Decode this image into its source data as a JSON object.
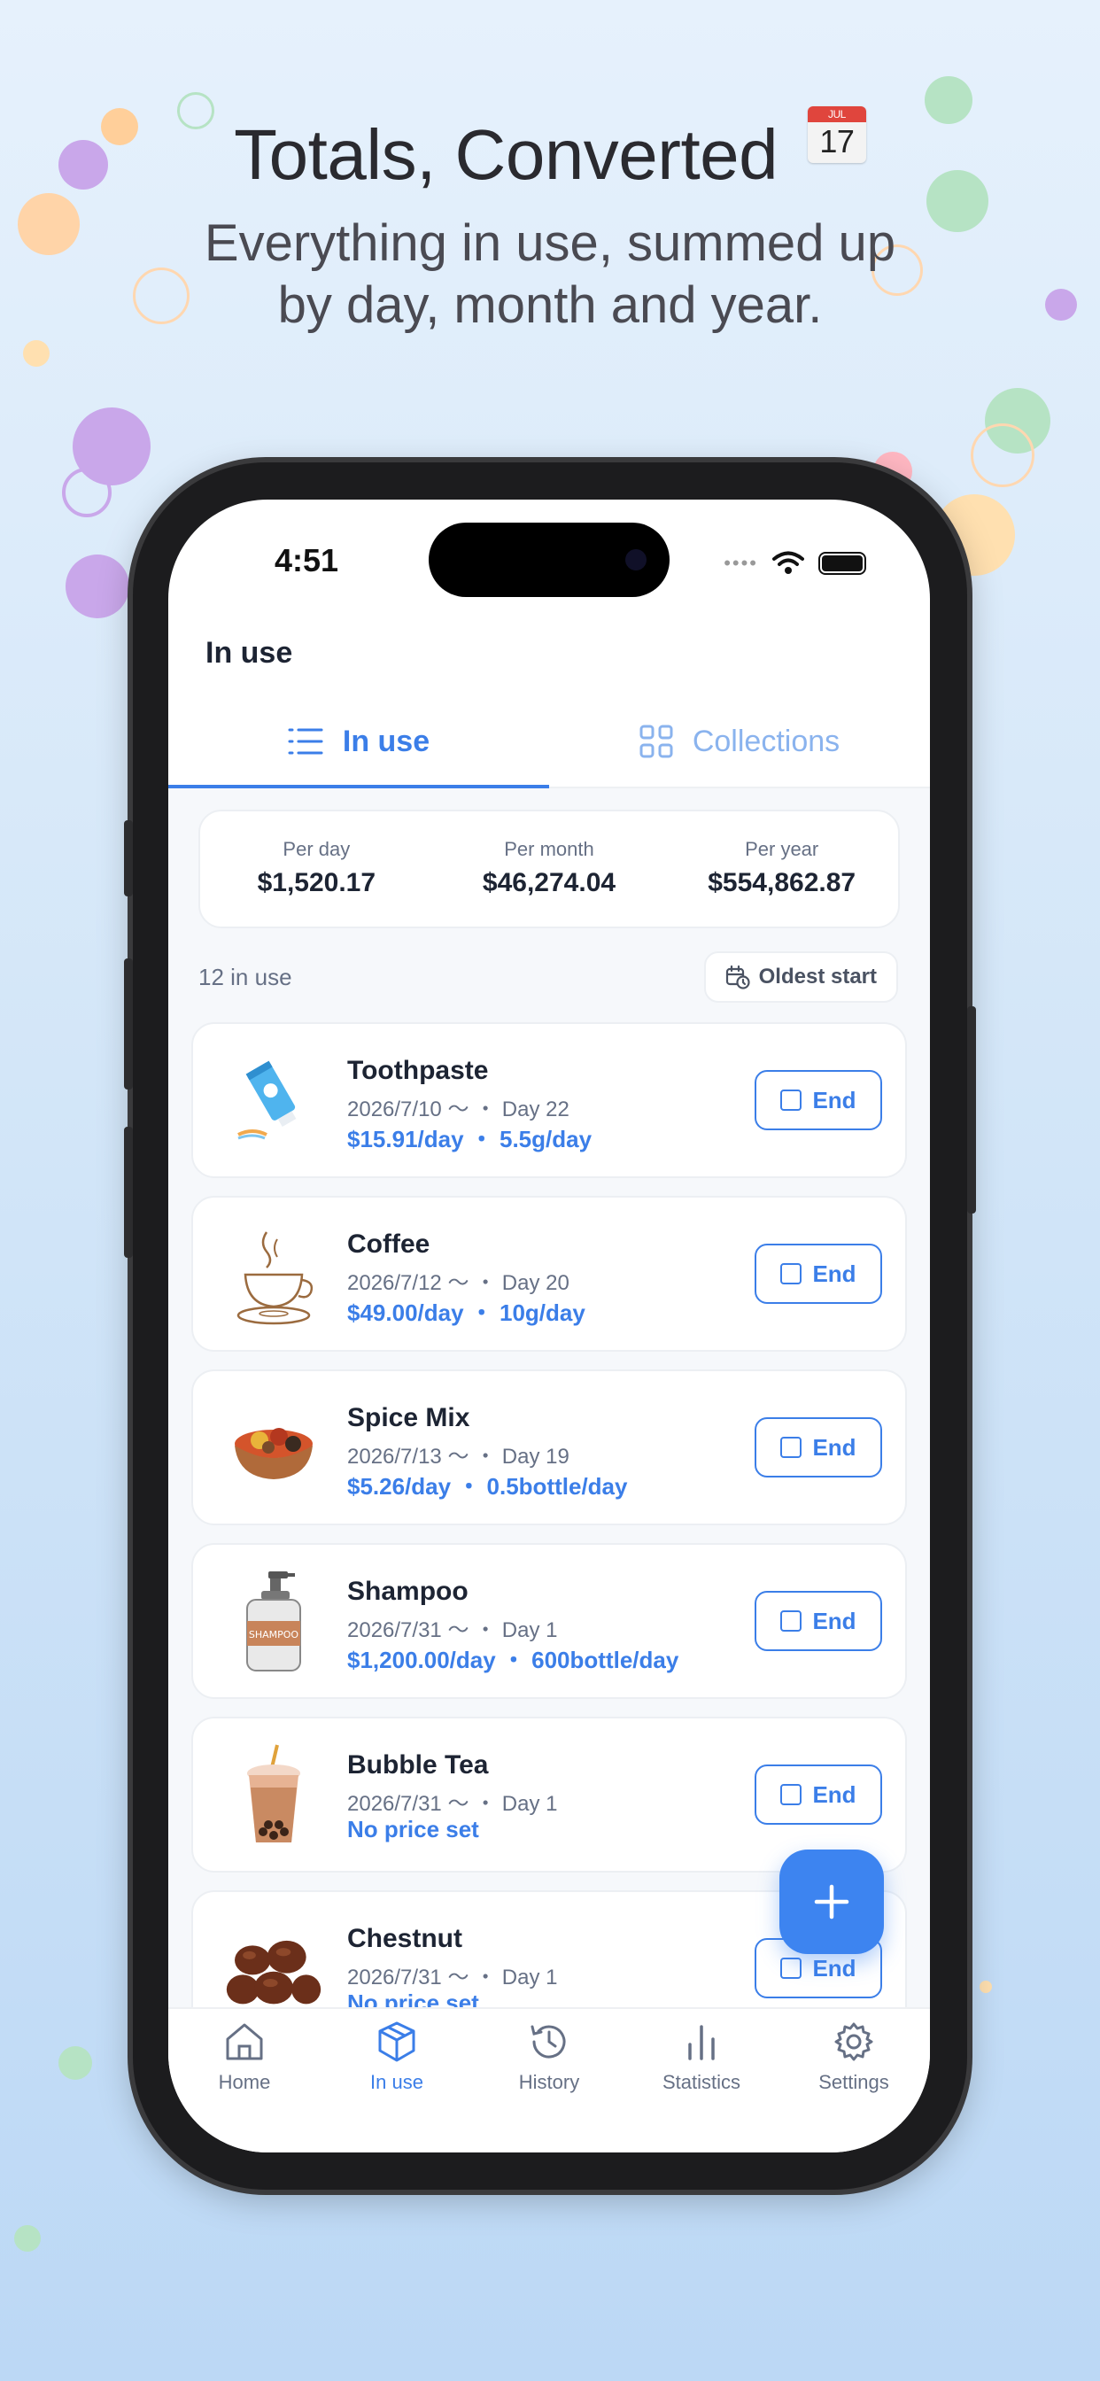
{
  "promo": {
    "headline": "Totals, Converted",
    "calendar_icon": {
      "name": "calendar-emoji-icon",
      "month": "JUL",
      "day": "17"
    },
    "subhead_line1": "Everything in use, summed up",
    "subhead_line2": "by day, month and year."
  },
  "status_bar": {
    "time": "4:51"
  },
  "header": {
    "title": "In use"
  },
  "tabs": [
    {
      "label": "In use",
      "icon": "list-icon",
      "active": true
    },
    {
      "label": "Collections",
      "icon": "grid-icon",
      "active": false
    }
  ],
  "totals": [
    {
      "label": "Per day",
      "value": "$1,520.17"
    },
    {
      "label": "Per month",
      "value": "$46,274.04"
    },
    {
      "label": "Per year",
      "value": "$554,862.87"
    }
  ],
  "list_meta": {
    "count_label": "12 in use",
    "sort_label": "Oldest start"
  },
  "items": [
    {
      "name": "Toothpaste",
      "date": "2026/7/10 〜 ・ Day 22",
      "rate": "$15.91/day ・ 5.5g/day",
      "end_label": "End",
      "icon": "toothpaste-icon"
    },
    {
      "name": "Coffee",
      "date": "2026/7/12 〜 ・ Day 20",
      "rate": "$49.00/day ・ 10g/day",
      "end_label": "End",
      "icon": "coffee-cup-icon"
    },
    {
      "name": "Spice Mix",
      "date": "2026/7/13 〜 ・ Day 19",
      "rate": "$5.26/day ・ 0.5bottle/day",
      "end_label": "End",
      "icon": "spice-bowl-icon"
    },
    {
      "name": "Shampoo",
      "date": "2026/7/31 〜 ・ Day 1",
      "rate": "$1,200.00/day ・ 600bottle/day",
      "end_label": "End",
      "icon": "shampoo-bottle-icon",
      "bottle_label": "SHAMPOO"
    },
    {
      "name": "Bubble Tea",
      "date": "2026/7/31 〜 ・ Day 1",
      "rate": "No price set",
      "end_label": "End",
      "icon": "bubble-tea-icon"
    },
    {
      "name": "Chestnut",
      "date": "2026/7/31 〜 ・ Day 1",
      "rate": "No price set",
      "end_label": "End",
      "icon": "chestnut-icon"
    }
  ],
  "tabbar": [
    {
      "label": "Home",
      "icon": "home-icon",
      "active": false
    },
    {
      "label": "In use",
      "icon": "box-icon",
      "active": true
    },
    {
      "label": "History",
      "icon": "history-icon",
      "active": false
    },
    {
      "label": "Statistics",
      "icon": "bar-chart-icon",
      "active": false
    },
    {
      "label": "Settings",
      "icon": "gear-icon",
      "active": false
    }
  ],
  "colors": {
    "accent": "#3b7ee8",
    "fab": "#3d84f0",
    "background_top": "#e6f1fc",
    "background_bottom": "#bcd8f5"
  }
}
